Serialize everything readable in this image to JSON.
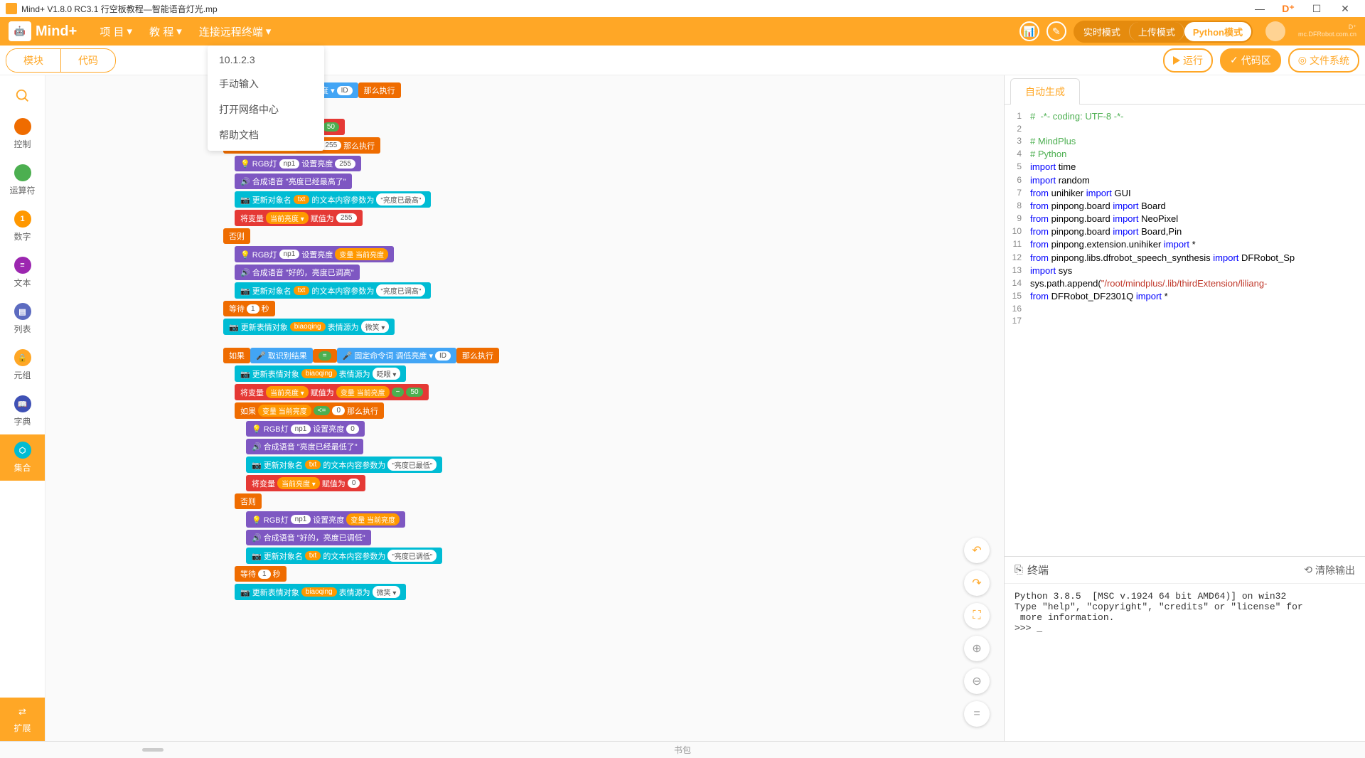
{
  "window": {
    "title": "Mind+ V1.8.0 RC3.1  行空板教程—智能语音灯光.mp"
  },
  "logo_text": "Mind+",
  "menus": {
    "project": "项 目",
    "tutorial": "教 程",
    "remote": "连接远程终端"
  },
  "dropdown": {
    "ip": "10.1.2.3",
    "manual": "手动输入",
    "network": "打开网络中心",
    "help": "帮助文档"
  },
  "modes": {
    "realtime": "实时模式",
    "upload": "上传模式",
    "python": "Python模式"
  },
  "df_text": "mc.DFRobot.com.cn",
  "tabs": {
    "blocks": "模块",
    "code": "代码"
  },
  "buttons": {
    "run": "运行",
    "code_area": "代码区",
    "file_system": "文件系统"
  },
  "categories": [
    {
      "label": "控制",
      "color": "#ef6c00",
      "icon": ""
    },
    {
      "label": "运算符",
      "color": "#4caf50",
      "icon": ""
    },
    {
      "label": "数字",
      "color": "#ff9800",
      "icon": "1"
    },
    {
      "label": "文本",
      "color": "#9c27b0",
      "icon": "≡"
    },
    {
      "label": "列表",
      "color": "#5c6bc0",
      "icon": "▤"
    },
    {
      "label": "元组",
      "color": "#ffa726",
      "icon": "🔒"
    },
    {
      "label": "字典",
      "color": "#3f51b5",
      "icon": "📖"
    },
    {
      "label": "集合",
      "color": "#00bcd4",
      "icon": "⬡"
    }
  ],
  "extension_label": "扩展",
  "search_icon_color": "#ffa726",
  "code_tab": "自动生成",
  "code_lines": [
    {
      "n": 1,
      "t": "#  -*- coding: UTF-8 -*-",
      "cls": "c-comment"
    },
    {
      "n": 2,
      "t": ""
    },
    {
      "n": 3,
      "t": "# MindPlus",
      "cls": "c-comment"
    },
    {
      "n": 4,
      "t": "# Python",
      "cls": "c-comment"
    },
    {
      "n": 5,
      "parts": [
        {
          "t": "import",
          "c": "c-keyword"
        },
        {
          "t": " time"
        }
      ]
    },
    {
      "n": 6,
      "parts": [
        {
          "t": "import",
          "c": "c-keyword"
        },
        {
          "t": " random"
        }
      ]
    },
    {
      "n": 7,
      "parts": [
        {
          "t": "from",
          "c": "c-keyword"
        },
        {
          "t": " unihiker "
        },
        {
          "t": "import",
          "c": "c-keyword"
        },
        {
          "t": " GUI"
        }
      ]
    },
    {
      "n": 8,
      "parts": [
        {
          "t": "from",
          "c": "c-keyword"
        },
        {
          "t": " pinpong.board "
        },
        {
          "t": "import",
          "c": "c-keyword"
        },
        {
          "t": " Board"
        }
      ]
    },
    {
      "n": 9,
      "parts": [
        {
          "t": "from",
          "c": "c-keyword"
        },
        {
          "t": " pinpong.board "
        },
        {
          "t": "import",
          "c": "c-keyword"
        },
        {
          "t": " NeoPixel"
        }
      ]
    },
    {
      "n": 10,
      "parts": [
        {
          "t": "from",
          "c": "c-keyword"
        },
        {
          "t": " pinpong.board "
        },
        {
          "t": "import",
          "c": "c-keyword"
        },
        {
          "t": " Board,Pin"
        }
      ]
    },
    {
      "n": 11,
      "parts": [
        {
          "t": "from",
          "c": "c-keyword"
        },
        {
          "t": " pinpong.extension.unihiker "
        },
        {
          "t": "import",
          "c": "c-keyword"
        },
        {
          "t": " *"
        }
      ]
    },
    {
      "n": 12,
      "parts": [
        {
          "t": "from",
          "c": "c-keyword"
        },
        {
          "t": " pinpong.libs.dfrobot_speech_synthesis "
        },
        {
          "t": "import",
          "c": "c-keyword"
        },
        {
          "t": " DFRobot_Sp"
        }
      ]
    },
    {
      "n": 13,
      "parts": [
        {
          "t": "import",
          "c": "c-keyword"
        },
        {
          "t": " sys"
        }
      ]
    },
    {
      "n": 14,
      "parts": [
        {
          "t": "sys.path.append("
        },
        {
          "t": "\"/root/mindplus/.lib/thirdExtension/liliang-",
          "c": "c-string"
        }
      ]
    },
    {
      "n": 15,
      "parts": [
        {
          "t": "from",
          "c": "c-keyword"
        },
        {
          "t": " DFRobot_DF2301Q "
        },
        {
          "t": "import",
          "c": "c-keyword"
        },
        {
          "t": " *"
        }
      ]
    },
    {
      "n": 16,
      "t": ""
    },
    {
      "n": 17,
      "t": ""
    }
  ],
  "terminal": {
    "title": "终端",
    "clear": "清除输出",
    "body": "Python 3.8.5  [MSC v.1924 64 bit AMD64)] on win32\nType \"help\", \"copyright\", \"credits\" or \"license\" for\n more information.\n>>> _"
  },
  "bottom_label": "书包",
  "blocks": {
    "if_bright": "如果",
    "fixed_cmd": "固定命令词 调高亮度",
    "id": "ID",
    "then": "那么执行",
    "update_face": "更新表情对象",
    "biaoqing": "biaoqing",
    "face_src": "表情源为",
    "blink": "眨眼",
    "smile": "微笑",
    "set_var": "将变量",
    "cur_bright": "当前亮度",
    "assign": "赋值为",
    "var": "变量 当前亮度",
    "ge": ">=",
    "le": "<=",
    "v255": "255",
    "v50": "50",
    "v0": "0",
    "v1": "1",
    "rgb": "RGB灯",
    "np1": "np1",
    "set_bright": "设置亮度",
    "voice": "合成语音",
    "bright_high": "亮度已经最高了",
    "bright_low": "亮度已经最低了",
    "update_obj": "更新对象名",
    "txt": "txt",
    "text_content": "的文本内容参数为",
    "bright_is_high": "亮度已最高",
    "bright_is_low": "亮度已最低",
    "ok_bright_up": "好的，亮度已调高",
    "ok_bright_down": "好的，亮度已调低",
    "bright_up": "亮度已调高",
    "bright_down": "亮度已调低",
    "else": "否则",
    "wait": "等待",
    "sec": "秒",
    "get_result": "取识别结果",
    "eq": "=",
    "low_cmd": "固定命令词 调低亮度",
    "plus": "+",
    "minus": "−"
  }
}
